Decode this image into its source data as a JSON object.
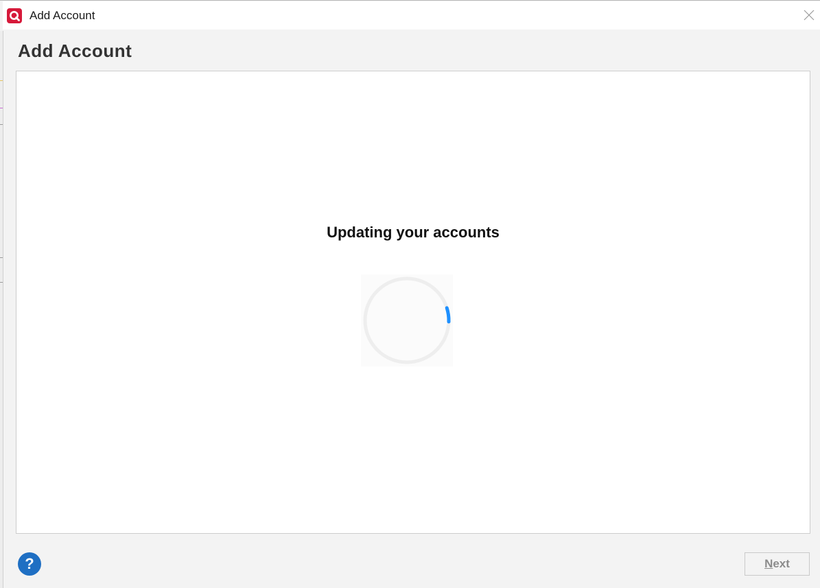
{
  "window": {
    "title": "Add Account",
    "brand_color": "#d6193a"
  },
  "page": {
    "heading": "Add Account",
    "status_message": "Updating your accounts",
    "spinner_color": "#1e90ff",
    "spinner_track_color": "#eeeeee"
  },
  "footer": {
    "help_symbol": "?",
    "help_color": "#1f6fc3",
    "next_mnemonic": "N",
    "next_rest": "ext",
    "next_enabled": false
  },
  "icons": {
    "app": "qlik-logo-icon",
    "close": "close-icon",
    "help": "help-icon",
    "spinner": "loading-spinner-icon"
  }
}
